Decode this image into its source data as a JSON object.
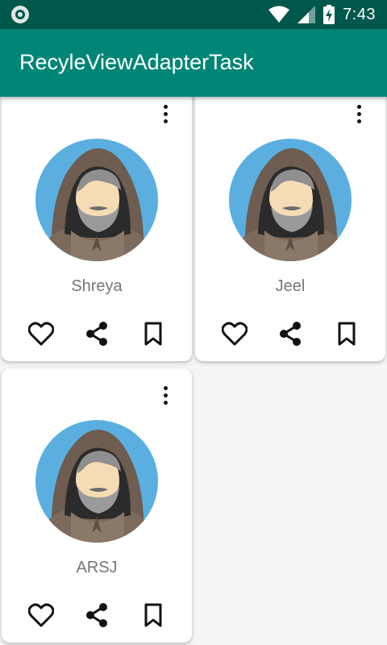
{
  "status_bar": {
    "time": "7:43"
  },
  "app_bar": {
    "title": "RecyleViewAdapterTask"
  },
  "cards": [
    {
      "name": "Shreya"
    },
    {
      "name": "Jeel"
    },
    {
      "name": "ARSJ"
    }
  ],
  "colors": {
    "status_bar": "#00574b",
    "app_bar": "#008577",
    "avatar_bg": "#5aafe0"
  },
  "icons": {
    "card_menu": "more-vert-icon",
    "like": "heart-icon",
    "share": "share-icon",
    "save": "bookmark-icon"
  }
}
